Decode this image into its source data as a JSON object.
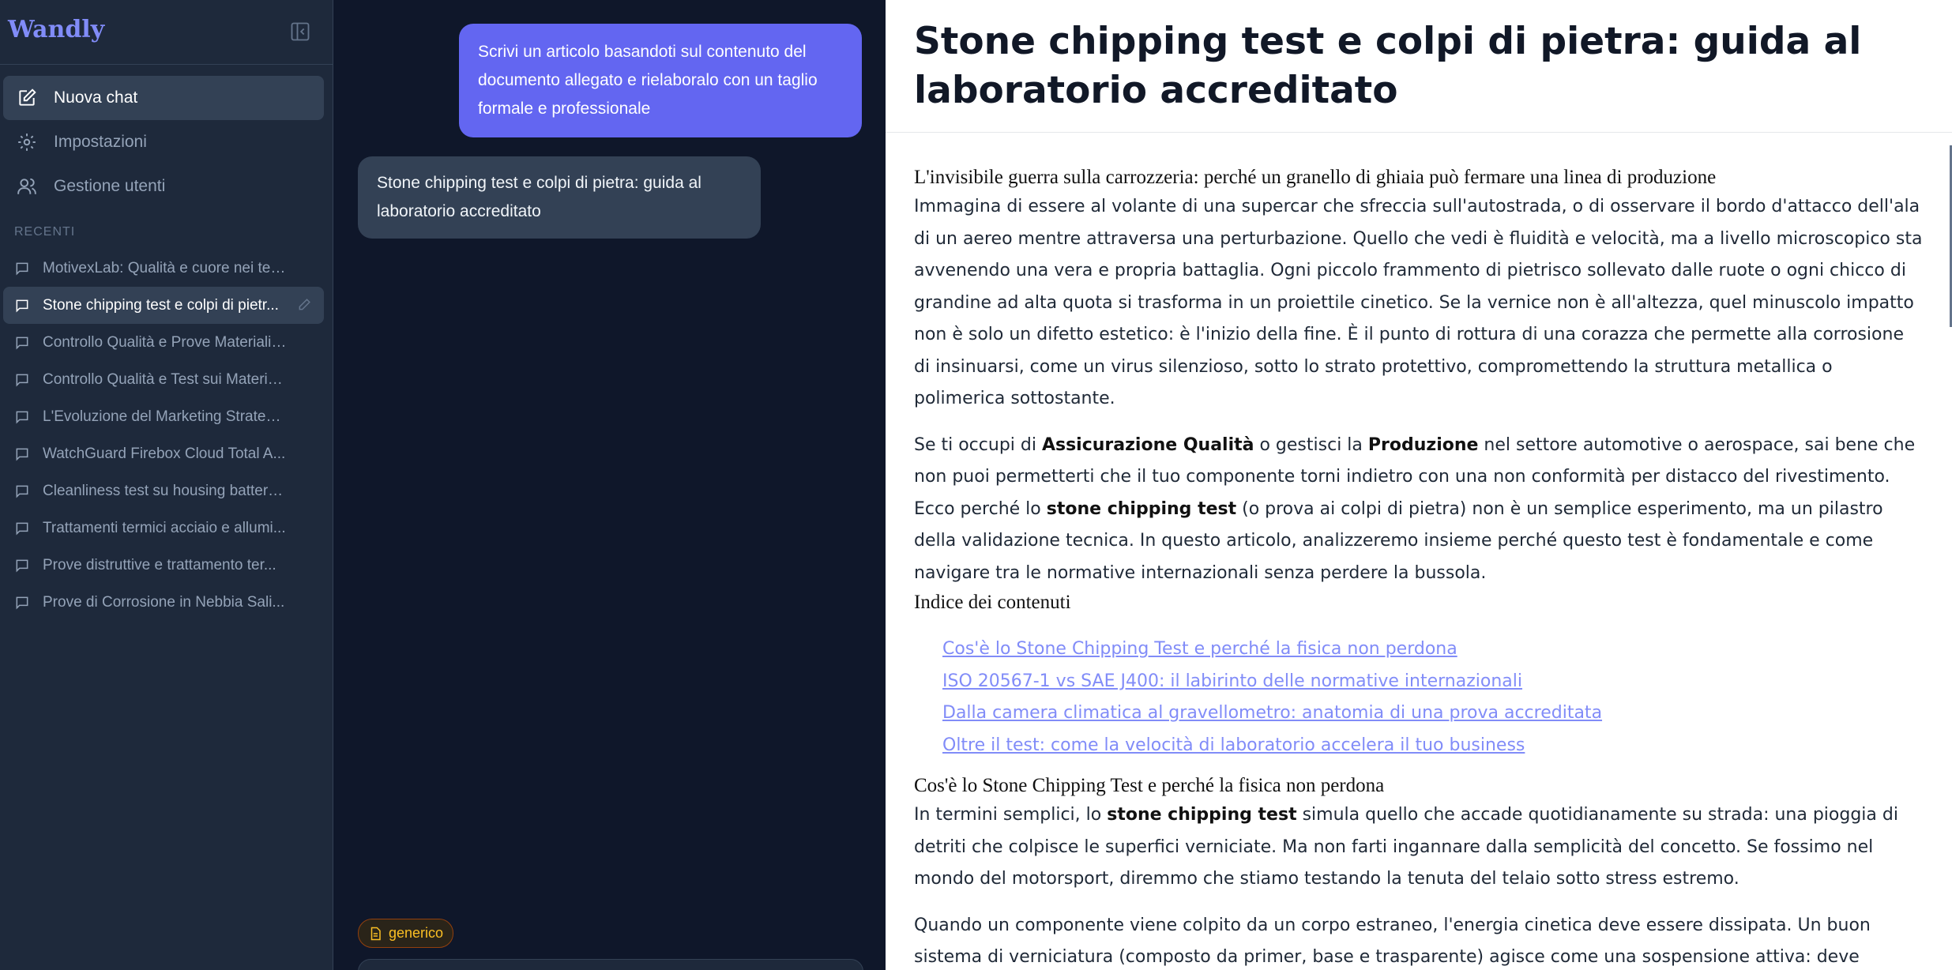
{
  "sidebar": {
    "brand": "Wandly",
    "nav": [
      {
        "label": "Nuova chat",
        "icon": "pencil-square-icon"
      },
      {
        "label": "Impostazioni",
        "icon": "gear-icon"
      },
      {
        "label": "Gestione utenti",
        "icon": "users-icon"
      }
    ],
    "recent_label": "RECENTI",
    "recent": [
      "MotivexLab: Qualità e cuore nei tes...",
      "Stone chipping test e colpi di pietr...",
      "Controllo Qualità e Prove Materiali ...",
      "Controllo Qualità e Test sui Materia...",
      "L'Evoluzione del Marketing Strategi...",
      "WatchGuard Firebox Cloud Total A...",
      "Cleanliness test su housing battery:...",
      "Trattamenti termici acciaio e allumi...",
      "Prove distruttive e trattamento ter...",
      "Prove di Corrosione in Nebbia Sali..."
    ]
  },
  "chat": {
    "user_message": "Scrivi un articolo basandoti sul contenuto del documento allegato e rielaboralo con un taglio formale e professionale",
    "assistant_message": "Stone chipping test e colpi di pietra: guida al laboratorio accreditato",
    "attachment_tag": "generico"
  },
  "document": {
    "title": "Stone chipping test e colpi di pietra: guida al laboratorio accreditato",
    "h_intro": "L'invisibile guerra sulla carrozzeria: perché un granello di ghiaia può fermare una linea di produzione",
    "p1": "Immagina di essere al volante di una supercar che sfreccia sull'autostrada, o di osservare il bordo d'attacco dell'ala di un aereo mentre attraversa una perturbazione. Quello che vedi è fluidità e velocità, ma a livello microscopico sta avvenendo una vera e propria battaglia. Ogni piccolo frammento di pietrisco sollevato dalle ruote o ogni chicco di grandine ad alta quota si trasforma in un proiettile cinetico. Se la vernice non è all'altezza, quel minuscolo impatto non è solo un difetto estetico: è l'inizio della fine. È il punto di rottura di una corazza che permette alla corrosione di insinuarsi, come un virus silenzioso, sotto lo strato protettivo, compromettendo la struttura metallica o polimerica sottostante.",
    "p2": {
      "a": "Se ti occupi di ",
      "b1": "Assicurazione Qualità",
      "c": " o gestisci la ",
      "b2": "Produzione",
      "d": " nel settore automotive o aerospace, sai bene che non puoi permetterti che il tuo componente torni indietro con una non conformità per distacco del rivestimento. Ecco perché lo ",
      "b3": "stone chipping test",
      "e": " (o prova ai colpi di pietra) non è un semplice esperimento, ma un pilastro della validazione tecnica. In questo articolo, analizzeremo insieme perché questo test è fondamentale e come navigare tra le normative internazionali senza perdere la bussola."
    },
    "h_toc": "Indice dei contenuti",
    "toc": [
      "Cos'è lo Stone Chipping Test e perché la fisica non perdona",
      "ISO 20567-1 vs SAE J400: il labirinto delle normative internazionali",
      "Dalla camera climatica al gravellometro: anatomia di una prova accreditata",
      "Oltre il test: come la velocità di laboratorio accelera il tuo business"
    ],
    "h_section1": "Cos'è lo Stone Chipping Test e perché la fisica non perdona",
    "p3": {
      "a": "In termini semplici, lo ",
      "b": "stone chipping test",
      "c": " simula quello che accade quotidianamente su strada: una pioggia di detriti che colpisce le superfici verniciate. Ma non farti ingannare dalla semplicità del concetto. Se fossimo nel mondo del motorsport, diremmo che stiamo testando la tenuta del telaio sotto stress estremo."
    },
    "p4": "Quando un componente viene colpito da un corpo estraneo, l'energia cinetica deve essere dissipata. Un buon sistema di verniciatura (composto da primer, base e trasparente) agisce come una sospensione attiva: deve assorbire l'urto senza"
  }
}
